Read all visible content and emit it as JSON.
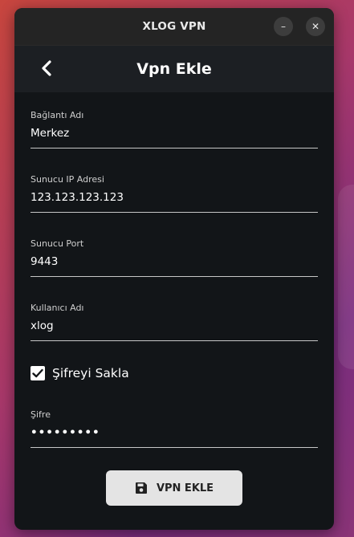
{
  "window": {
    "title": "XLOG VPN",
    "minimize_glyph": "–",
    "close_glyph": "✕"
  },
  "appbar": {
    "back_icon": "chevron-left-icon",
    "title": "Vpn Ekle"
  },
  "form": {
    "connection_name": {
      "label": "Bağlantı Adı",
      "value": "Merkez"
    },
    "server_ip": {
      "label": "Sunucu IP Adresi",
      "value": "123.123.123.123"
    },
    "server_port": {
      "label": "Sunucu Port",
      "value": "9443"
    },
    "username": {
      "label": "Kullanıcı Adı",
      "value": "xlog"
    },
    "save_password": {
      "label": "Şifreyi Sakla",
      "checked": true
    },
    "password": {
      "label": "Şifre",
      "value": "•••••••••"
    }
  },
  "submit": {
    "label": "VPN EKLE",
    "icon": "save-icon"
  }
}
